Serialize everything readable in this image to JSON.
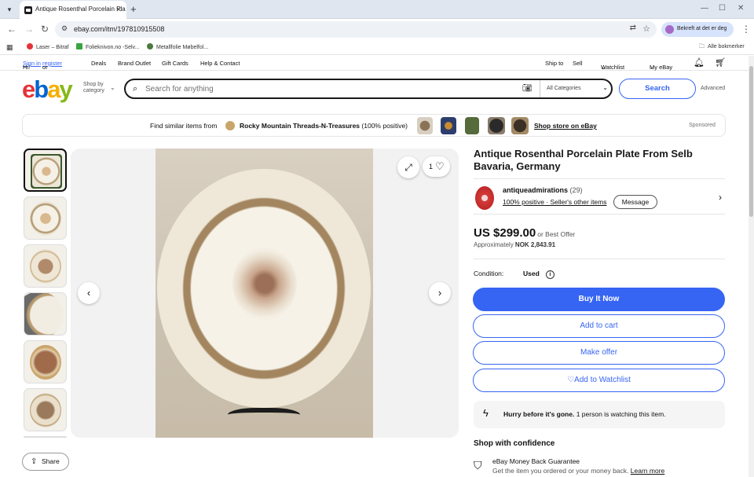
{
  "browser": {
    "tab_title": "Antique Rosenthal Porcelain Pla",
    "url": "ebay.com/itm/197810915508",
    "profile_label": "Bekreft at det er deg",
    "bookmarks": [
      "Laser – Bitraf",
      "Folieknivon.no -Selv...",
      "Metallfolie Møbelfol..."
    ],
    "all_bookmarks": "Alle bokmerker"
  },
  "toplinks": {
    "greeting": "Hi!",
    "sign_in": "Sign in",
    "or": "or",
    "register": "register",
    "deals": "Deals",
    "brand_outlet": "Brand Outlet",
    "gift_cards": "Gift Cards",
    "help": "Help & Contact",
    "ship_to": "Ship to",
    "sell": "Sell",
    "watchlist": "Watchlist",
    "my_ebay": "My eBay"
  },
  "header": {
    "logo": [
      "e",
      "b",
      "a",
      "y"
    ],
    "shop_by_1": "Shop by",
    "shop_by_2": "category",
    "search_placeholder": "Search for anything",
    "category": "All Categories",
    "search_button": "Search",
    "advanced": "Advanced"
  },
  "sponsor": {
    "find_similar": "Find similar items from",
    "seller": "Rocky Mountain Threads-N-Treasures",
    "pct": "(100% positive)",
    "shop_store": "Shop store on eBay",
    "sponsored": "Sponsored"
  },
  "gallery": {
    "like_count": "1",
    "share": "Share"
  },
  "listing": {
    "title": "Antique Rosenthal Porcelain Plate From Selb Bavaria, Germany",
    "seller_name": "antiqueadmirations",
    "seller_count": "(29)",
    "positive": "100% positive",
    "other_items": "Seller's other items",
    "message": "Message",
    "price": "US $299.00",
    "best_offer": "or Best Offer",
    "approx_label": "Approximately",
    "approx_value": "NOK 2,843.91",
    "condition_label": "Condition:",
    "condition_value": "Used",
    "buy_now": "Buy It Now",
    "add_cart": "Add to cart",
    "make_offer": "Make offer",
    "watchlist": "Add to Watchlist",
    "hurry_bold": "Hurry before it's gone.",
    "hurry_rest": "1 person is watching this item.",
    "shop_confidence": "Shop with confidence",
    "guarantee_title": "eBay Money Back Guarantee",
    "guarantee_sub": "Get the item you ordered or your money back.",
    "learn_more": "Learn more"
  },
  "colors": {
    "accent": "#3665f3",
    "logo_e": "#e53238",
    "logo_b": "#0064d2",
    "logo_a": "#f5af02",
    "logo_y": "#86b817"
  }
}
